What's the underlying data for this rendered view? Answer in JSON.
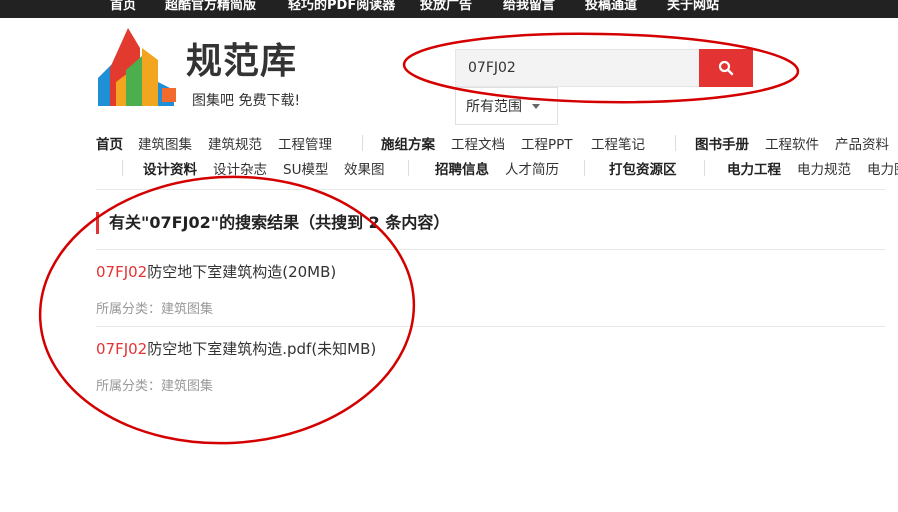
{
  "topnav": {
    "items": [
      "首页",
      "超酷官方精简版",
      "轻巧的PDF阅读器",
      "投放广告",
      "给我留言",
      "投稿通道",
      "关于网站"
    ]
  },
  "logo": {
    "name": "规范库",
    "slogan": "图集吧 免费下载!"
  },
  "search": {
    "value": "07FJ02",
    "scope_label": "所有范围",
    "button_icon": "search-icon"
  },
  "nav": {
    "row1": [
      {
        "label": "首页",
        "bold": true
      },
      {
        "label": "建筑图集",
        "bold": false
      },
      {
        "label": "建筑规范",
        "bold": false
      },
      {
        "label": "工程管理",
        "bold": false
      },
      {
        "label": "施组方案",
        "bold": true
      },
      {
        "label": "工程文档",
        "bold": false
      },
      {
        "label": "工程PPT",
        "bold": false
      },
      {
        "label": "工程笔记",
        "bold": false
      },
      {
        "label": "图书手册",
        "bold": true
      },
      {
        "label": "工程软件",
        "bold": false
      },
      {
        "label": "产品资料",
        "bold": false
      }
    ],
    "row2": [
      {
        "label": "设计资料",
        "bold": true
      },
      {
        "label": "设计杂志",
        "bold": false
      },
      {
        "label": "SU模型",
        "bold": false
      },
      {
        "label": "效果图",
        "bold": false
      },
      {
        "label": "招聘信息",
        "bold": true
      },
      {
        "label": "人才简历",
        "bold": false
      },
      {
        "label": "打包资源区",
        "bold": true
      },
      {
        "label": "电力工程",
        "bold": true
      },
      {
        "label": "电力规范",
        "bold": false
      },
      {
        "label": "电力图",
        "bold": false
      }
    ]
  },
  "results": {
    "heading": "有关\"07FJ02\"的搜索结果（共搜到 2 条内容）",
    "items": [
      {
        "keyword": "07FJ02",
        "title_rest": "防空地下室建筑构造(20MB)",
        "meta": "所属分类：建筑图集"
      },
      {
        "keyword": "07FJ02",
        "title_rest": "防空地下室建筑构造.pdf(未知MB)",
        "meta": "所属分类：建筑图集"
      }
    ]
  },
  "colors": {
    "accent": "#e33333",
    "annotation": "#d40000",
    "topbar": "#222222"
  }
}
